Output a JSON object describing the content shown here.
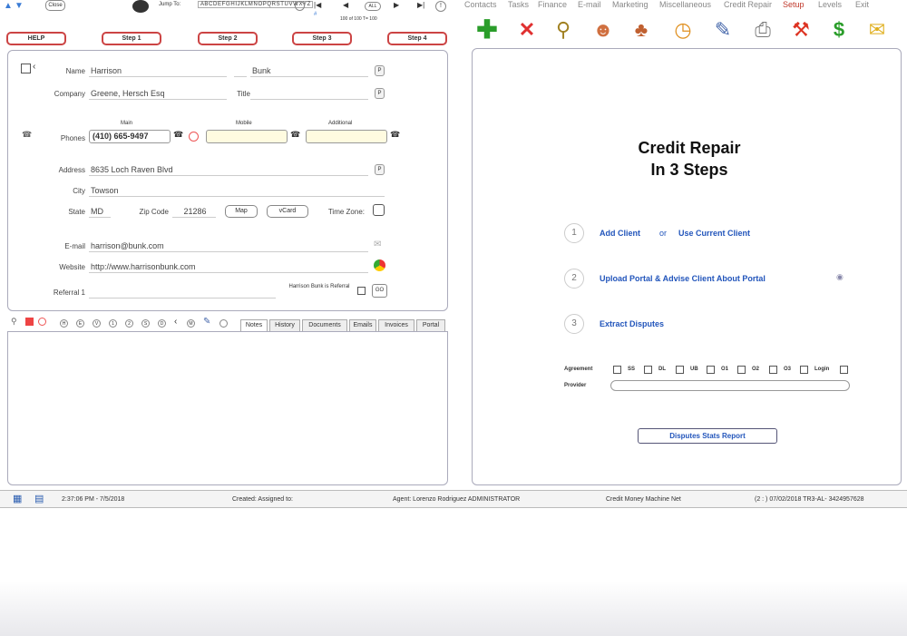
{
  "top": {
    "close_label": "Close",
    "jump_to_label": "Jump To:",
    "jump_letters": "A B C D E F G H I J K L M N O P Q R S T U V W X Y Z",
    "record_count": "100 of 100 T= 100",
    "all_label": "ALL",
    "hash_label": "#",
    "nav_first": "|◀",
    "nav_prev": "◀",
    "nav_next": "▶",
    "nav_last": "▶|"
  },
  "menu": [
    "Contacts",
    "Tasks",
    "Finance",
    "E-mail",
    "Marketing",
    "Miscellaneous",
    "Credit Repair",
    "Setup",
    "Levels",
    "Exit"
  ],
  "menu_active_index": 7,
  "steps": [
    "HELP",
    "Step 1",
    "Step 2",
    "Step 3",
    "Step 4"
  ],
  "form": {
    "name_label": "Name",
    "first_name": "Harrison",
    "last_name": "Bunk",
    "company_label": "Company",
    "company": "Greene, Hersch Esq",
    "title_label": "Title",
    "title": "",
    "phones_label": "Phones",
    "main_label": "Main",
    "main_phone": "(410) 665-9497",
    "mobile_label": "Mobile",
    "mobile_phone": "",
    "additional_label": "Additional",
    "additional_phone": "",
    "address_label": "Address",
    "address": "8635 Loch Raven Blvd",
    "city_label": "City",
    "city": "Towson",
    "state_label": "State",
    "state": "MD",
    "zip_label": "Zip Code",
    "zip": "21286",
    "map_label": "Map",
    "vcard_label": "vCard",
    "timezone_label": "Time Zone:",
    "email_label": "E-mail",
    "email": "harrison@bunk.com",
    "website_label": "Website",
    "website": "http://www.harrisonbunk.com",
    "referral_label": "Referral 1",
    "referral": "",
    "referral_note": "Harrison Bunk is Referral",
    "go_label": "GO",
    "p_label": "P"
  },
  "icon_row": [
    "H",
    "E",
    "V",
    "1",
    "2",
    "S",
    "D",
    "M"
  ],
  "tabs": [
    "Notes",
    "History",
    "Documents",
    "Emails",
    "Invoices",
    "Portal"
  ],
  "credit": {
    "title_line1": "Credit Repair",
    "title_line2": "In 3 Steps",
    "step1_num": "1",
    "step1_a": "Add Client",
    "step1_or": "or",
    "step1_b": "Use Current Client",
    "step2_num": "2",
    "step2": "Upload Portal & Advise Client About Portal",
    "step3_num": "3",
    "step3": "Extract Disputes",
    "agreement_label": "Agreement",
    "check_labels": [
      "SS",
      "DL",
      "UB",
      "O1",
      "O2",
      "O3",
      "Login"
    ],
    "provider_label": "Provider",
    "report_button": "Disputes Stats Report"
  },
  "status": {
    "time": "2:37:06 PM  -  7/5/2018",
    "created": "Created:   Assigned to:",
    "agent": "Agent: Lorenzo Rodriguez ADMINISTRATOR",
    "site": "Credit Money Machine Net",
    "session": "(2 : )  07/02/2018 TR3-AL- 3424957628"
  }
}
